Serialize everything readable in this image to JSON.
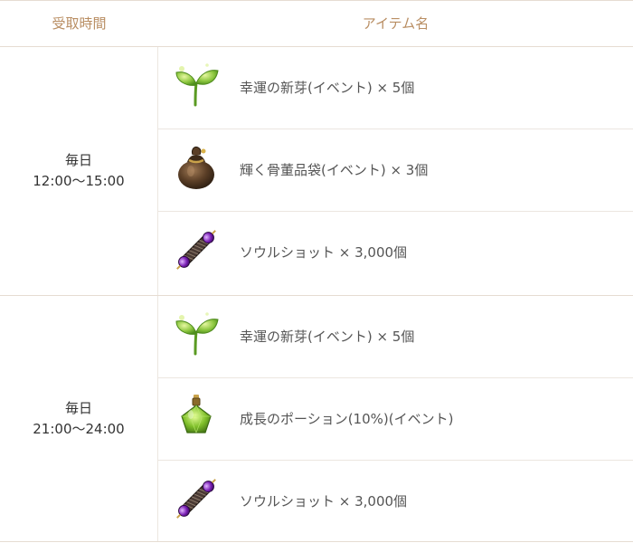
{
  "header": {
    "time_col": "受取時間",
    "item_col": "アイテム名"
  },
  "groups": [
    {
      "time_line1": "毎日",
      "time_line2": "12:00～15:00",
      "items": [
        {
          "icon": "sprout-icon",
          "label": "幸運の新芽(イベント) × 5個"
        },
        {
          "icon": "bag-icon",
          "label": "輝く骨董品袋(イベント) × 3個"
        },
        {
          "icon": "soulshot-icon",
          "label": "ソウルショット × 3,000個"
        }
      ]
    },
    {
      "time_line1": "毎日",
      "time_line2": "21:00～24:00",
      "items": [
        {
          "icon": "sprout-icon",
          "label": "幸運の新芽(イベント) × 5個"
        },
        {
          "icon": "potion-icon",
          "label": "成長のポーション(10%)(イベント)"
        },
        {
          "icon": "soulshot-icon",
          "label": "ソウルショット × 3,000個"
        }
      ]
    }
  ]
}
